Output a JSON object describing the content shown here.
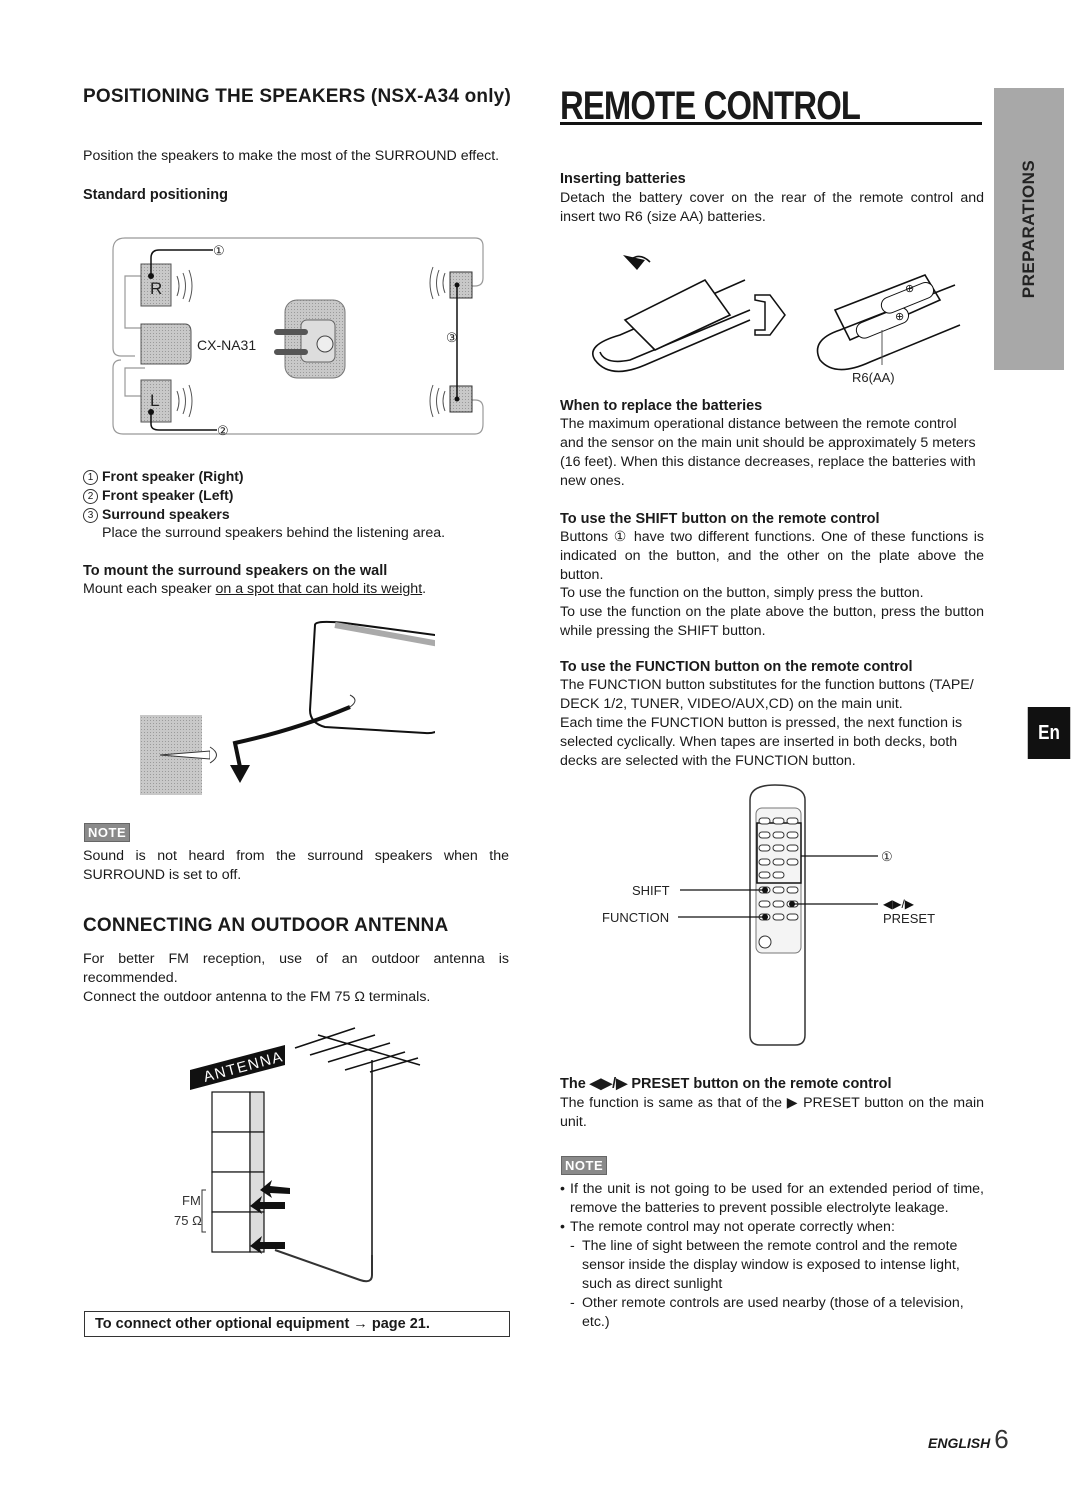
{
  "left": {
    "positioning": {
      "title": "POSITIONING THE SPEAKERS (NSX-A34 only)",
      "intro": "Position the speakers to make the most of the SURROUND effect.",
      "subheading": "Standard positioning",
      "diagram": {
        "front_right_label": "R",
        "front_left_label": "L",
        "subwoofer_label": "CX-NA31",
        "callouts": [
          "①",
          "②",
          "③"
        ]
      },
      "legend": [
        {
          "marker": "1",
          "label": "Front speaker (Right)"
        },
        {
          "marker": "2",
          "label": "Front speaker (Left)"
        },
        {
          "marker": "3",
          "label": "Surround speakers"
        }
      ],
      "legend_note": "Place the surround speakers behind the listening area.",
      "wall_heading": "To mount the surround speakers on the wall",
      "wall_text_before": "Mount each speaker ",
      "wall_text_underlined": "on a spot that can hold its weight",
      "wall_text_after": "."
    },
    "note": {
      "badge": "NOTE",
      "text": "Sound is not heard from the surround speakers when the SURROUND is set to off."
    },
    "antenna": {
      "title": "CONNECTING AN OUTDOOR ANTENNA",
      "para1": "For better FM reception, use of an outdoor antenna is recommended.",
      "para2": "Connect the outdoor antenna to the FM 75 Ω terminals.",
      "diagram": {
        "banner": "ANTENNA",
        "terminal_label_fm": "FM",
        "terminal_label_ohm": "75 Ω"
      },
      "boxed_ref": "To connect other optional equipment → page 21."
    }
  },
  "right": {
    "title": "REMOTE CONTROL",
    "side_tab": "PREPARATIONS",
    "lang_tab": "En",
    "inserting": {
      "heading": "Inserting batteries",
      "text": "Detach the battery cover on the rear of the remote control and insert two R6 (size AA) batteries.",
      "battery_label": "R6(AA)"
    },
    "replace": {
      "heading": "When to replace the batteries",
      "text": "The maximum operational distance between the remote control and the sensor on the main unit should be approximately 5 meters (16 feet).  When this distance decreases, replace the batteries with new ones."
    },
    "shift": {
      "heading": "To use the SHIFT button on the remote control",
      "lines": [
        "Buttons ① have two different functions. One of these functions is indicated on the button, and the other on the plate above the button.",
        "To use the function on the button, simply press the button.",
        "To use the function on the plate above the button, press the button while pressing the SHIFT button."
      ]
    },
    "function": {
      "heading": "To use the FUNCTION button on the remote control",
      "lines": [
        "The FUNCTION button substitutes for the function buttons (TAPE/ DECK 1/2, TUNER, VIDEO/AUX,CD) on the main unit.",
        "Each time the FUNCTION button is pressed, the next function is selected cyclically. When tapes are inserted in both decks, both decks are selected with the FUNCTION button."
      ]
    },
    "remote_diagram": {
      "callout_1": "①",
      "shift_label": "SHIFT",
      "function_label": "FUNCTION",
      "preset_symbol": "◀▶/▶",
      "preset_label": "PRESET"
    },
    "preset": {
      "heading": "The ◀▶/▶ PRESET button on the remote control",
      "text": "The function is same as that of the ▶ PRESET button on the main unit."
    },
    "note": {
      "badge": "NOTE",
      "bullets": [
        "If the unit is not going to be used for an extended period of time, remove the batteries to prevent possible electrolyte leakage.",
        "The remote control may not operate correctly when:"
      ],
      "sub_bullets": [
        "The line of sight between the remote control and the remote sensor inside the display window is exposed to intense light, such as direct sunlight",
        "Other remote controls are used nearby (those of  a television, etc.)"
      ]
    }
  },
  "footer": {
    "language": "ENGLISH",
    "page_number": "6"
  }
}
